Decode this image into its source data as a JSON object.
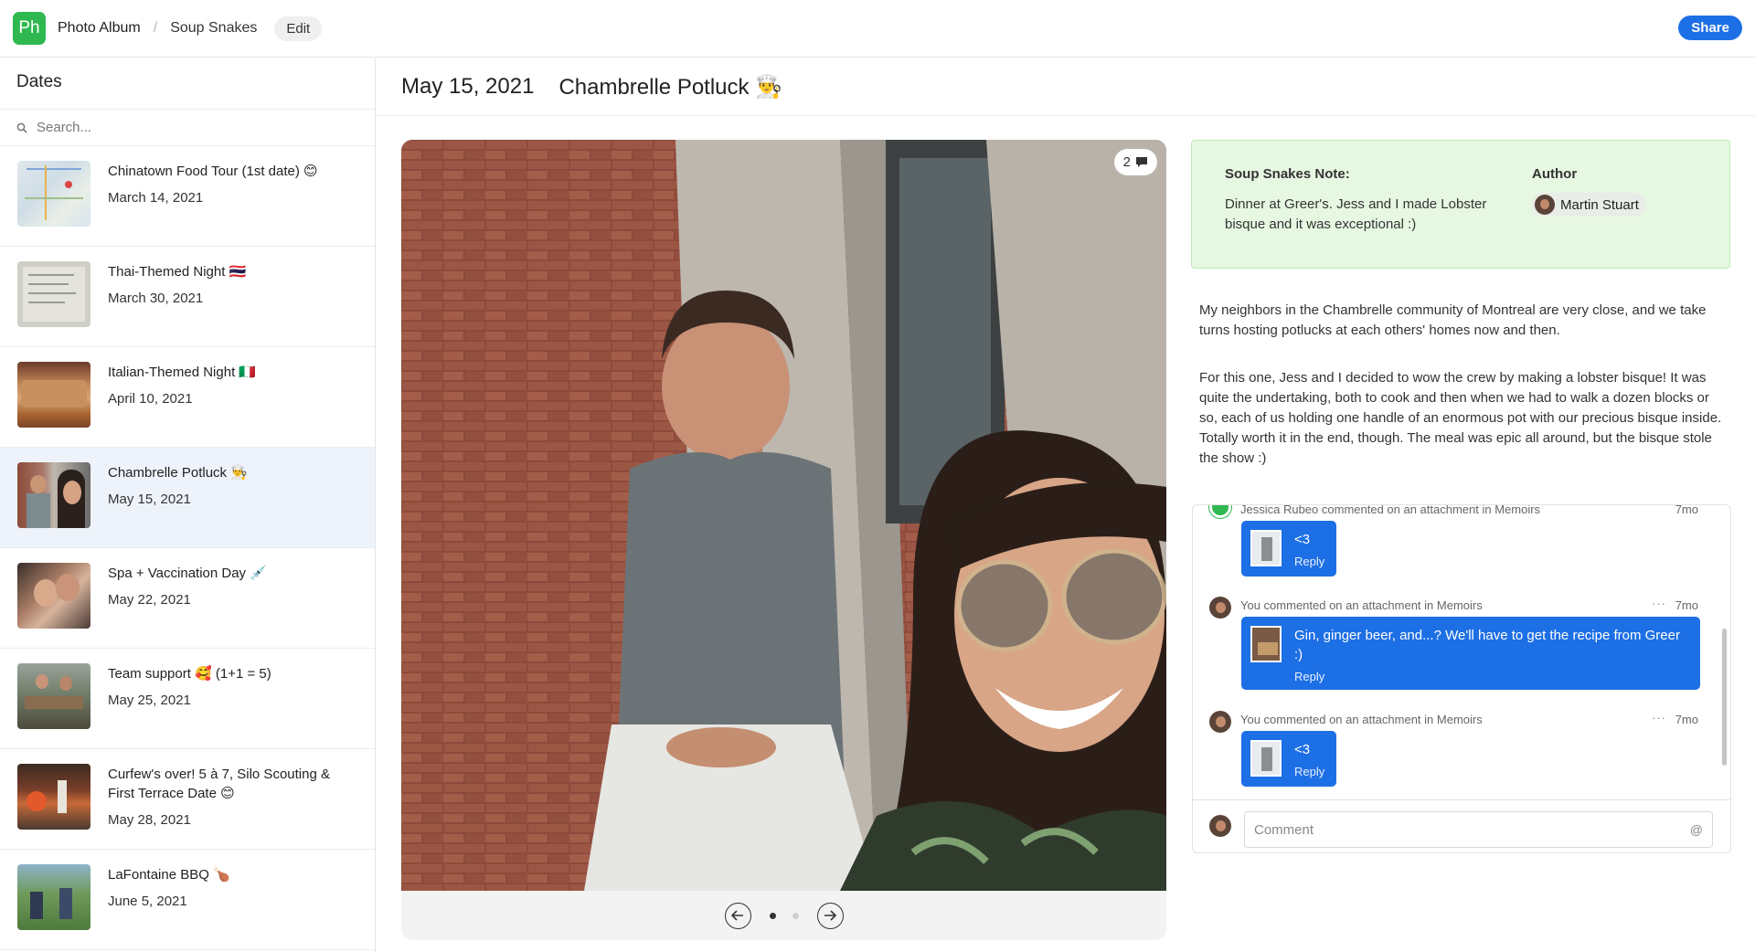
{
  "app": {
    "badge": "Ph",
    "name": "Photo Album"
  },
  "breadcrumb": {
    "separator": "/",
    "current": "Soup Snakes",
    "edit_label": "Edit"
  },
  "share_label": "Share",
  "sidebar": {
    "title": "Dates",
    "search_placeholder": "Search...",
    "items": [
      {
        "title": "Chinatown Food Tour (1st date) 😊",
        "date": "March 14, 2021"
      },
      {
        "title": "Thai-Themed Night 🇹🇭",
        "date": "March 30, 2021"
      },
      {
        "title": "Italian-Themed Night 🇮🇹",
        "date": "April 10, 2021"
      },
      {
        "title": "Chambrelle Potluck 👨‍🍳",
        "date": "May 15, 2021"
      },
      {
        "title": "Spa + Vaccination Day 💉",
        "date": "May 22, 2021"
      },
      {
        "title": "Team support 🥰  (1+1 = 5)",
        "date": "May 25, 2021"
      },
      {
        "title": "Curfew's over! 5 à 7, Silo Scouting & First Terrace Date 😊",
        "date": "May 28, 2021"
      },
      {
        "title": "LaFontaine BBQ 🍗",
        "date": "June 5, 2021"
      }
    ],
    "selected_index": 3
  },
  "main": {
    "date": "May 15, 2021",
    "title": "Chambrelle Potluck 👨‍🍳",
    "photo": {
      "comment_count": "2",
      "page_count": 2,
      "current_page": 1
    },
    "note": {
      "label": "Soup Snakes Note:",
      "body": "Dinner at Greer's. Jess and I made Lobster bisque and it was exceptional :)",
      "author_label": "Author",
      "author_name": "Martin Stuart"
    },
    "description": [
      "My neighbors in the Chambrelle community of Montreal are very close, and we take turns hosting potlucks at each others' homes now and then.",
      "For this one, Jess and I decided to wow the crew by making a lobster bisque! It was quite the undertaking, both to cook and then when we had to walk a dozen blocks or so, each of us holding one handle of an enormous pot with our precious bisque inside. Totally worth it in the end, though. The meal was epic all around, but the bisque stole the show :)"
    ],
    "comments": [
      {
        "meta": "Jessica Rubeo commented on an attachment in Memoirs",
        "time": "7mo",
        "text": "<3",
        "reply": "Reply"
      },
      {
        "meta": "You commented on an attachment in Memoirs",
        "time": "7mo",
        "more": "···",
        "text": "Gin, ginger beer, and...? We'll have to get the recipe from Greer :)",
        "reply": "Reply"
      },
      {
        "meta": "You commented on an attachment in Memoirs",
        "time": "7mo",
        "more": "···",
        "text": "<3",
        "reply": "Reply"
      }
    ],
    "comment_placeholder": "Comment",
    "comment_at": "@"
  },
  "colors": {
    "accent": "#1d6fe5",
    "brand": "#2fb84f",
    "note_bg": "#e6f8e1",
    "selected_bg": "#eef3fb"
  }
}
